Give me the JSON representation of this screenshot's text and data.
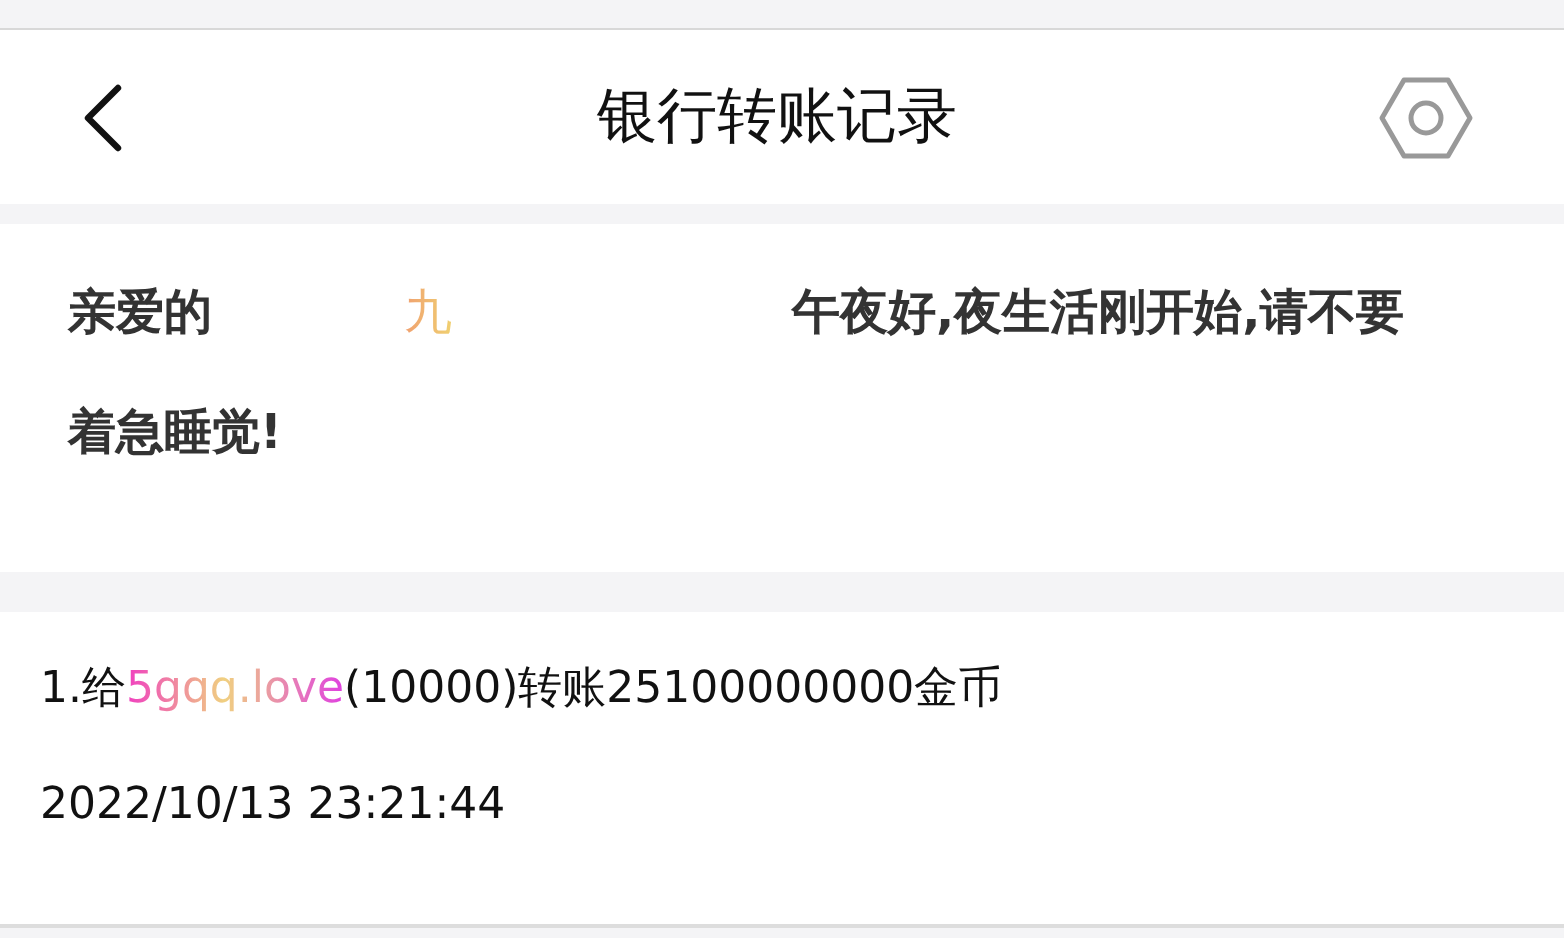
{
  "header": {
    "title": "银行转账记录"
  },
  "greeting": {
    "before": "亲爱的",
    "name": "九",
    "after": "午夜好,夜生活刚开始,请不要着急睡觉!"
  },
  "records": [
    {
      "prefix": "1.给",
      "user": "5gqq.love",
      "detail": "(10000)转账25100000000金币",
      "time": "2022/10/13 23:21:44"
    }
  ]
}
